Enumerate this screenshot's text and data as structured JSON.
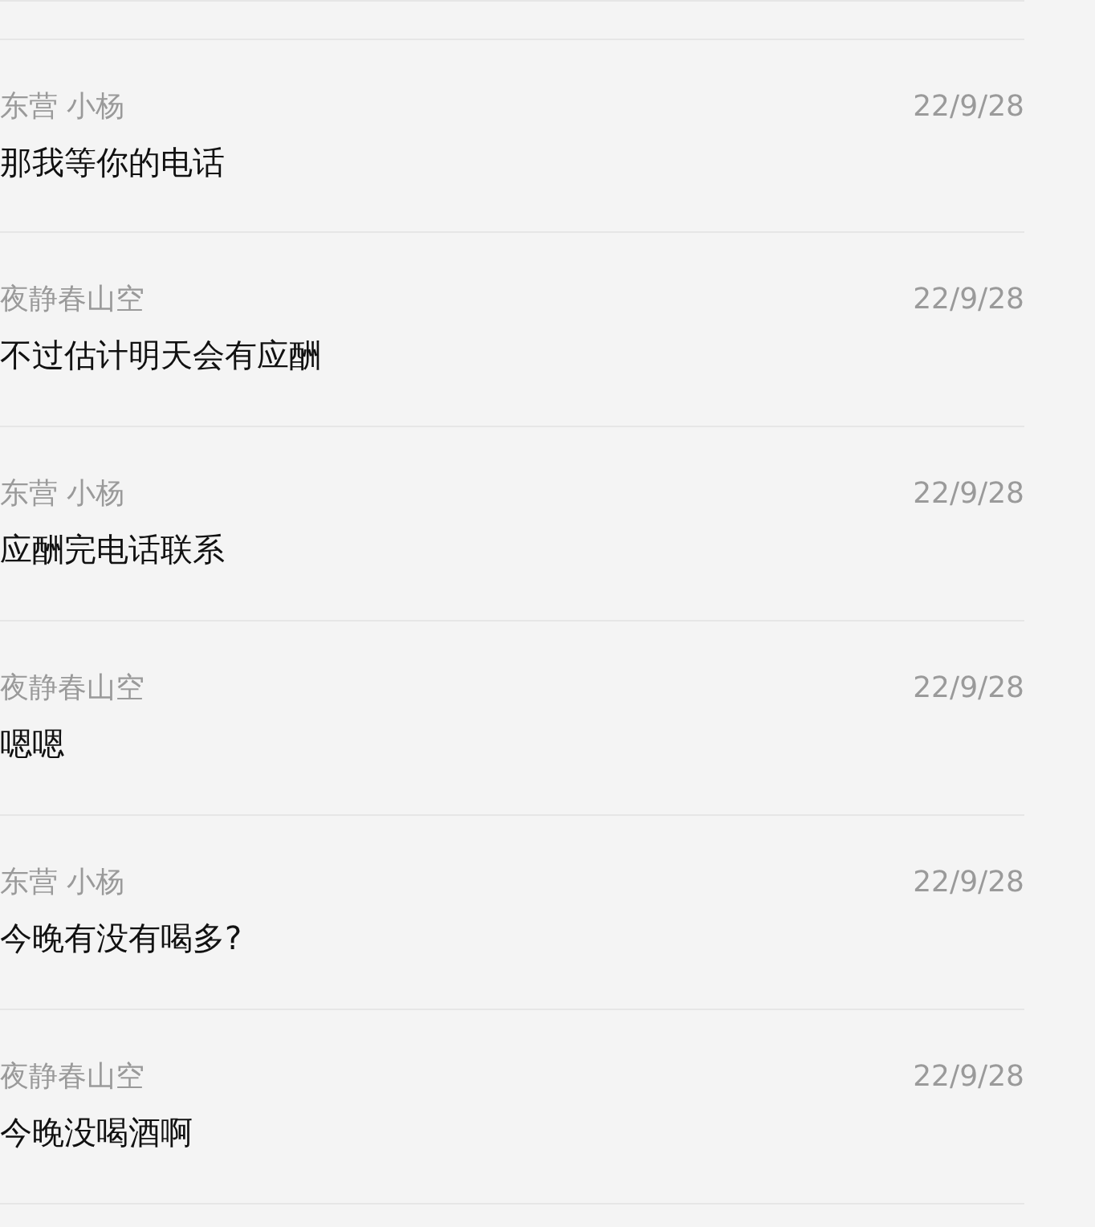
{
  "messages": [
    {
      "sender": "东营 小杨",
      "date": "22/9/28",
      "text": "那我等你的电话"
    },
    {
      "sender": "夜静春山空",
      "date": "22/9/28",
      "text": "不过估计明天会有应酬"
    },
    {
      "sender": "东营 小杨",
      "date": "22/9/28",
      "text": "应酬完电话联系"
    },
    {
      "sender": "夜静春山空",
      "date": "22/9/28",
      "text": "嗯嗯"
    },
    {
      "sender": "东营 小杨",
      "date": "22/9/28",
      "text": "今晚有没有喝多?"
    },
    {
      "sender": "夜静春山空",
      "date": "22/9/28",
      "text": "今晚没喝酒啊"
    }
  ]
}
